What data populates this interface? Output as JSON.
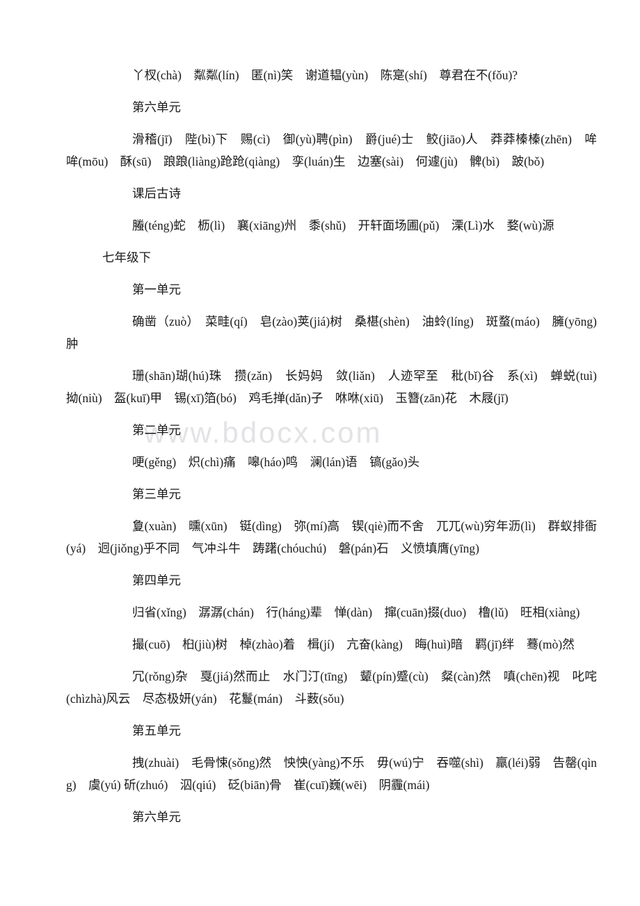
{
  "document": {
    "watermark": "www.bdocx.com",
    "blocks": [
      {
        "kind": "content",
        "name": "line-unit5-terms",
        "text": "丫杈(chà)　粼粼(lín)　匿(nì)笑　谢道韫(yùn)　陈寔(shí)　尊君在不(fǒu)?"
      },
      {
        "kind": "heading",
        "name": "heading-unit-6",
        "text": "第六单元"
      },
      {
        "kind": "content",
        "name": "line-unit6-terms",
        "text": "滑稽(jī)　陛(bì)下　赐(cì)　御(yù)聘(pìn)　爵(jué)士　鲛(jiāo)人　莽莽榛榛(zhēn)　哞哞(mōu)　酥(sū)　踉踉(liàng)跄跄(qiàng)　孪(luán)生　边塞(sài)　何遽(jù)　髀(bì)　跛(bǒ)"
      },
      {
        "kind": "heading",
        "name": "heading-after-class-poems",
        "text": "课后古诗"
      },
      {
        "kind": "content",
        "name": "line-poems-terms",
        "text": "螣(téng)蛇　枥(lì)　襄(xiāng)州　黍(shǔ)　开轩面场圃(pǔ)　溧(Lì)水　婺(wù)源"
      },
      {
        "kind": "grade",
        "name": "heading-grade-7-second-term",
        "text": "七年级下"
      },
      {
        "kind": "heading",
        "name": "heading-unit-1",
        "text": "第一单元"
      },
      {
        "kind": "content",
        "name": "line-unit1-terms-a",
        "text": "确凿（zuò）　菜畦(qí)　皂(zào)荚(jiá)树　桑椹(shèn)　油蛉(líng)　斑蝥(máo)　臃(yōng)肿"
      },
      {
        "kind": "content",
        "name": "line-unit1-terms-b",
        "text": "珊(shān)瑚(hú)珠　攒(zǎn)　长妈妈　敛(liǎn)　人迹罕至　秕(bǐ)谷　系(xì)　蝉蜕(tuì)　拗(niù)　盔(kuī)甲　锡(xī)箔(bó)　鸡毛掸(dǎn)子　咻咻(xiū)　玉簪(zān)花　木屐(jī)"
      },
      {
        "kind": "heading",
        "name": "heading-unit-2",
        "text": "第二单元"
      },
      {
        "kind": "content",
        "name": "line-unit2-terms",
        "text": "哽(gěng)　炽(chì)痛　嗥(háo)鸣　澜(lán)语　镐(gǎo)头"
      },
      {
        "kind": "heading",
        "name": "heading-unit-3",
        "text": "第三单元"
      },
      {
        "kind": "content",
        "name": "line-unit3-terms",
        "text": "夐(xuàn)　曛(xūn)　铤(dìng)　弥(mí)高　锲(qiè)而不舍　兀兀(wù)穷年沥(lì)　群蚁排衙(yá)　迥(jiǒng)乎不同　气冲斗牛　踌躇(chóuchú)　磐(pán)石　义愤填膺(yīng)"
      },
      {
        "kind": "heading",
        "name": "heading-unit-4",
        "text": "第四单元"
      },
      {
        "kind": "content",
        "name": "line-unit4-terms-a",
        "text": "归省(xǐng)　潺潺(chán)　行(háng)辈　惮(dàn)　撺(cuān)掇(duo)　橹(lǔ)　旺相(xiàng)"
      },
      {
        "kind": "content",
        "name": "line-unit4-terms-b",
        "text": "撮(cuō)　桕(jiù)树　棹(zhào)着　楫(jí)　亢奋(kàng)　晦(huì)暗　羁(jī)绊　蓦(mò)然"
      },
      {
        "kind": "content",
        "name": "line-unit4-terms-c",
        "text": "冗(rǒng)杂　戛(jiá)然而止　水门汀(tīng)　颦(pín)蹙(cù)　粲(càn)然　嗔(chēn)视　叱咤(chìzhà)风云　尽态极妍(yán)　花鬘(mán)　斗薮(sǒu)"
      },
      {
        "kind": "heading",
        "name": "heading-unit-5",
        "text": "第五单元"
      },
      {
        "kind": "content",
        "name": "line-unit5b-terms",
        "text": "拽(zhuài)　毛骨悚(sǒng)然　怏怏(yàng)不乐　毋(wú)宁　吞噬(shì)　羸(léi)弱　告罄(qìng)　虞(yú) 斫(zhuó)　泅(qiú)　砭(biān)骨　崔(cuī)巍(wēi)　阴霾(mái)"
      },
      {
        "kind": "heading",
        "name": "heading-unit-6-second",
        "text": "第六单元"
      }
    ]
  }
}
